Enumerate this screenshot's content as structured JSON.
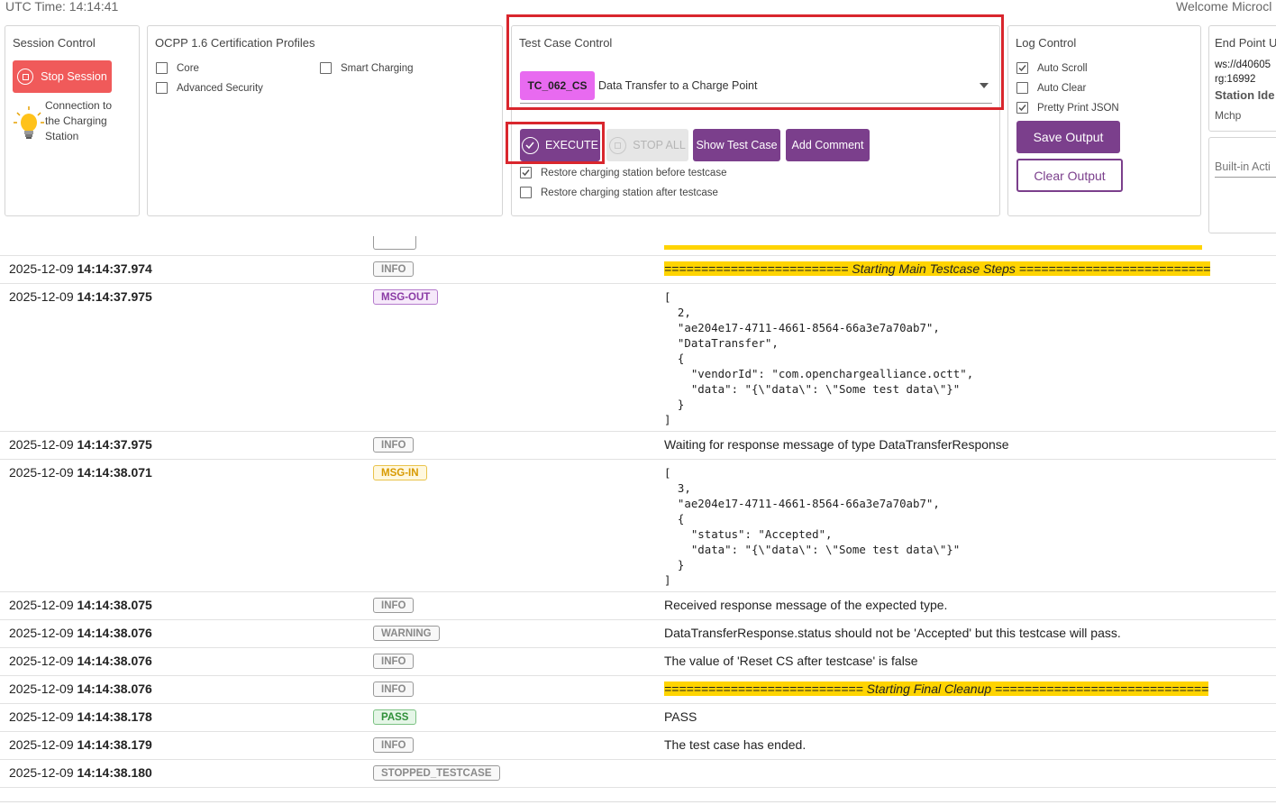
{
  "header": {
    "utc_time": "UTC Time: 14:14:41",
    "welcome": "Welcome Microcl"
  },
  "session_control": {
    "title": "Session Control",
    "stop_label": "Stop Session",
    "connection_text_1": "Connection to",
    "connection_text_2": "the Charging",
    "connection_text_3": "Station"
  },
  "profiles": {
    "title": "OCPP 1.6 Certification Profiles",
    "items": [
      {
        "label": "Core",
        "checked": false
      },
      {
        "label": "Smart Charging",
        "checked": false
      },
      {
        "label": "Advanced Security",
        "checked": false
      }
    ]
  },
  "test_case_control": {
    "title": "Test Case Control",
    "tc_id": "TC_062_CS",
    "tc_name": "Data Transfer to a Charge Point",
    "execute_label": "EXECUTE",
    "stop_all_label": "STOP ALL",
    "show_label": "Show Test Case",
    "comment_label": "Add Comment",
    "restore_before": "Restore charging station before testcase",
    "restore_after": "Restore charging station after testcase",
    "restore_before_checked": true,
    "restore_after_checked": false
  },
  "log_control": {
    "title": "Log Control",
    "items": [
      {
        "label": "Auto Scroll",
        "checked": true
      },
      {
        "label": "Auto Clear",
        "checked": false
      },
      {
        "label": "Pretty Print JSON",
        "checked": true
      }
    ],
    "save_label": "Save Output",
    "clear_label": "Clear Output"
  },
  "endpoint": {
    "title": "End Point U",
    "url_line_1": "ws://d40605",
    "url_line_2": "rg:16992",
    "station_label": "Station Ide",
    "station_value": "Mchp",
    "builtin": "Built-in Acti"
  },
  "log": [
    {
      "date": "2025-12-09",
      "time": "14:14:37.974",
      "type": "INFO",
      "message": "========================= Starting Main Testcase Steps =========================="
    },
    {
      "date": "2025-12-09",
      "time": "14:14:37.975",
      "type": "MSG-OUT",
      "message": "[\n  2,\n  \"ae204e17-4711-4661-8564-66a3e7a70ab7\",\n  \"DataTransfer\",\n  {\n    \"vendorId\": \"com.openchargealliance.octt\",\n    \"data\": \"{\\\"data\\\": \\\"Some test data\\\"}\"\n  }\n]"
    },
    {
      "date": "2025-12-09",
      "time": "14:14:37.975",
      "type": "INFO",
      "message": "Waiting for response message of type DataTransferResponse"
    },
    {
      "date": "2025-12-09",
      "time": "14:14:38.071",
      "type": "MSG-IN",
      "message": "[\n  3,\n  \"ae204e17-4711-4661-8564-66a3e7a70ab7\",\n  {\n    \"status\": \"Accepted\",\n    \"data\": \"{\\\"data\\\": \\\"Some test data\\\"}\"\n  }\n]"
    },
    {
      "date": "2025-12-09",
      "time": "14:14:38.075",
      "type": "INFO",
      "message": "Received response message of the expected type."
    },
    {
      "date": "2025-12-09",
      "time": "14:14:38.076",
      "type": "WARNING",
      "message": "DataTransferResponse.status should not be 'Accepted' but this testcase will pass."
    },
    {
      "date": "2025-12-09",
      "time": "14:14:38.076",
      "type": "INFO",
      "message": "The value of 'Reset CS after testcase' is false"
    },
    {
      "date": "2025-12-09",
      "time": "14:14:38.076",
      "type": "INFO",
      "message": "=========================== Starting Final Cleanup ============================="
    },
    {
      "date": "2025-12-09",
      "time": "14:14:38.178",
      "type": "PASS",
      "message": "PASS"
    },
    {
      "date": "2025-12-09",
      "time": "14:14:38.179",
      "type": "INFO",
      "message": "The test case has ended."
    },
    {
      "date": "2025-12-09",
      "time": "14:14:38.180",
      "type": "STOPPED_TESTCASE",
      "message": ""
    }
  ],
  "colors": {
    "accent": "#7b3f8c",
    "stop_red": "#f05a5a",
    "tc_badge": "#e86af0",
    "highlight": "#ffd400",
    "frame_red": "#d9262d"
  }
}
